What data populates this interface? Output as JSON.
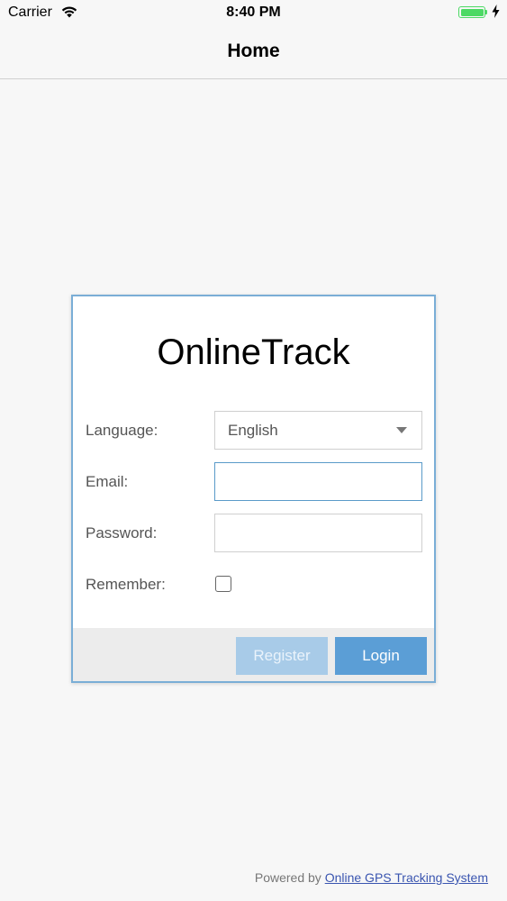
{
  "status_bar": {
    "carrier": "Carrier",
    "time": "8:40 PM",
    "battery_level": 1.0,
    "battery_color": "#4cd964"
  },
  "nav": {
    "title": "Home"
  },
  "login": {
    "brand": "OnlineTrack",
    "language_label": "Language:",
    "language_value": "English",
    "email_label": "Email:",
    "email_value": "",
    "password_label": "Password:",
    "password_value": "",
    "remember_label": "Remember:",
    "remember_checked": false,
    "register_label": "Register",
    "login_label": "Login"
  },
  "footer": {
    "powered_prefix": "Powered by",
    "link_text": "Online GPS Tracking System"
  },
  "colors": {
    "accent": "#5b9ed6",
    "card_border": "#7aaed6",
    "link": "#3a55b0"
  }
}
